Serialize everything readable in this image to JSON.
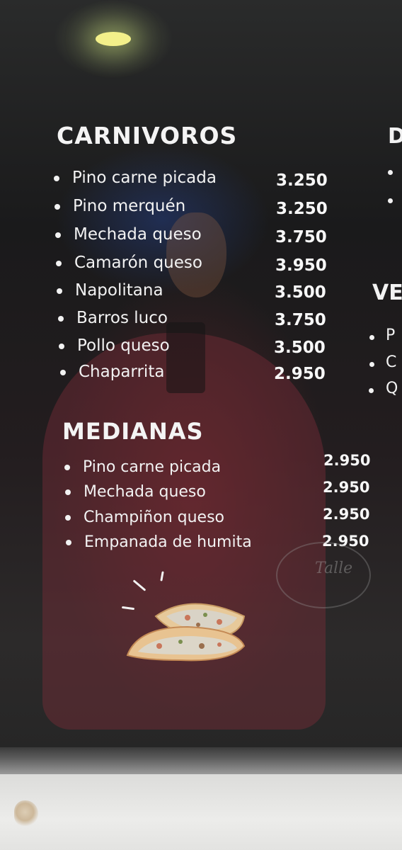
{
  "sections": [
    {
      "title": "CARNIVOROS",
      "items": [
        {
          "name": "Pino carne picada",
          "price": "3.250"
        },
        {
          "name": "Pino merquén",
          "price": "3.250"
        },
        {
          "name": "Mechada queso",
          "price": "3.750"
        },
        {
          "name": "Camarón queso",
          "price": "3.950"
        },
        {
          "name": "Napolitana",
          "price": "3.500"
        },
        {
          "name": "Barros luco",
          "price": "3.750"
        },
        {
          "name": "Pollo queso",
          "price": "3.500"
        },
        {
          "name": "Chaparrita",
          "price": "2.950"
        }
      ]
    },
    {
      "title": "MEDIANAS",
      "items": [
        {
          "name": "Pino carne picada",
          "price": "2.950"
        },
        {
          "name": "Mechada queso",
          "price": "2.950"
        },
        {
          "name": "Champiñon queso",
          "price": "2.950"
        },
        {
          "name": "Empanada de humita",
          "price": "2.950"
        }
      ]
    }
  ],
  "cut_off": {
    "title_1": "D",
    "title_2": "VE",
    "letters": [
      "P",
      "C",
      "Q"
    ]
  },
  "sticker_text": "Talle",
  "colors": {
    "text": "#f2f2f2",
    "screen_bg": "#1c1c1d"
  }
}
